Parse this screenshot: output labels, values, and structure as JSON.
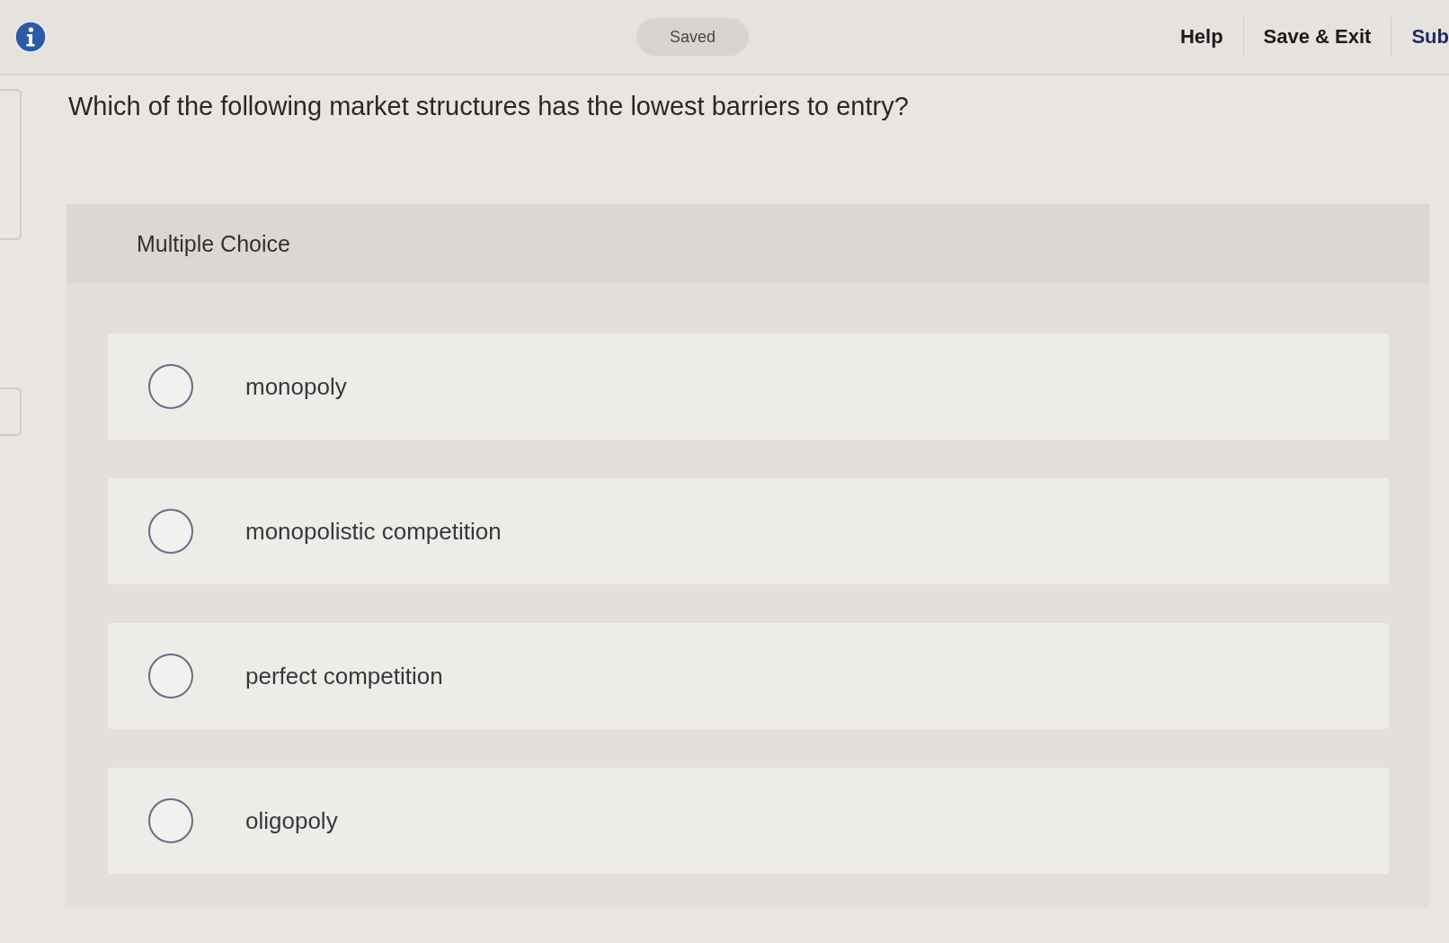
{
  "toolbar": {
    "saved_status": "Saved",
    "links": [
      {
        "label": "Help",
        "kind": "link"
      },
      {
        "label": "Save & Exit",
        "kind": "link"
      },
      {
        "label": "Sub",
        "kind": "submit"
      }
    ]
  },
  "question": {
    "prompt": "Which of the following market structures has the lowest barriers to entry?",
    "type_label": "Multiple Choice",
    "options": [
      {
        "label": "monopoly",
        "selected": false
      },
      {
        "label": "monopolistic competition",
        "selected": false
      },
      {
        "label": "perfect competition",
        "selected": false
      },
      {
        "label": "oligopoly",
        "selected": false
      }
    ]
  }
}
